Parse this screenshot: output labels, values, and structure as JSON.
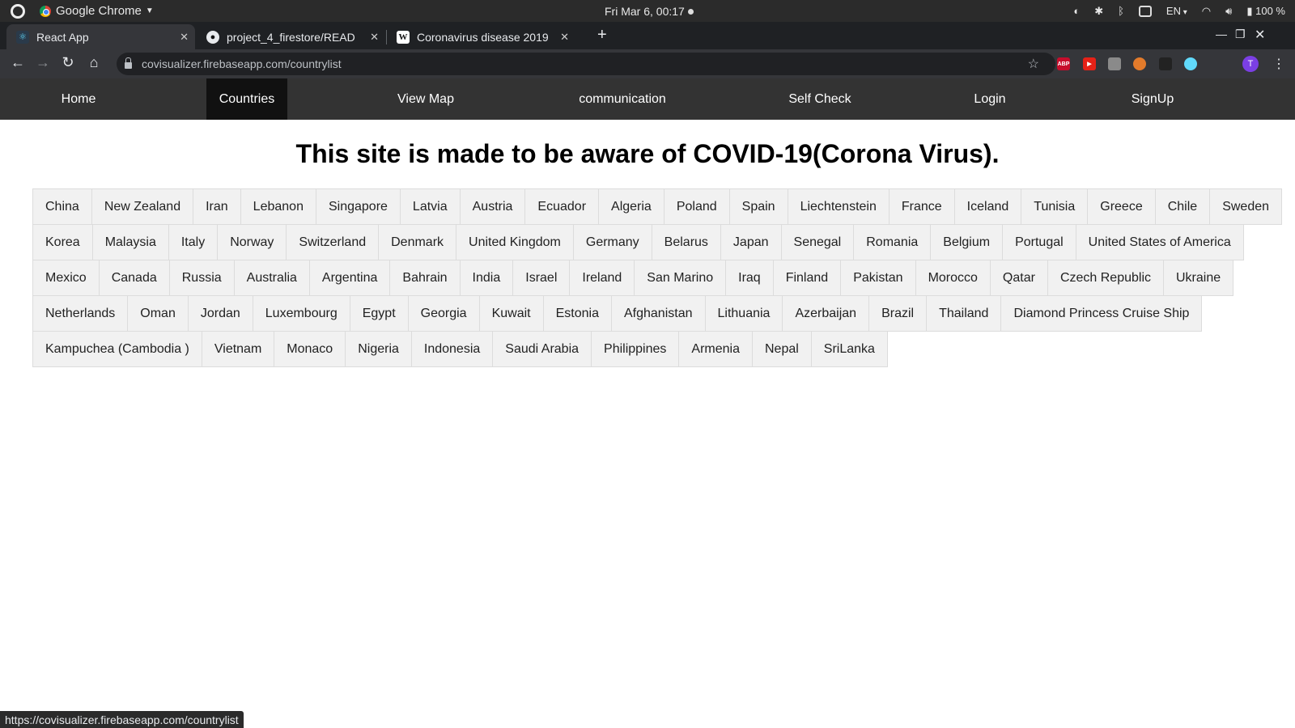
{
  "system_bar": {
    "app_name": "Google Chrome",
    "clock": "Fri Mar  6, 00:17",
    "language": "EN",
    "battery": "100 %"
  },
  "browser": {
    "tabs": [
      {
        "title": "React App",
        "icon": "react-icon",
        "active": true
      },
      {
        "title": "project_4_firestore/READ",
        "icon": "github-icon",
        "active": false
      },
      {
        "title": "Coronavirus disease 2019",
        "icon": "wikipedia-icon",
        "active": false
      }
    ],
    "url": "covisualizer.firebaseapp.com/countrylist",
    "profile_initial": "T",
    "extensions": [
      {
        "label": "ABP",
        "color": "#c70d2c"
      },
      {
        "label": "▶",
        "color": "#e62117"
      },
      {
        "label": "",
        "color": "#8a8a8a"
      },
      {
        "label": "",
        "color": "#e37b2b"
      },
      {
        "label": "",
        "color": "#222"
      },
      {
        "label": "",
        "color": "#61dafb"
      }
    ],
    "status_url": "https://covisualizer.firebaseapp.com/countrylist"
  },
  "nav": {
    "items": [
      {
        "label": "Home",
        "active": false
      },
      {
        "label": "Countries",
        "active": true
      },
      {
        "label": "View Map",
        "active": false
      },
      {
        "label": "communication",
        "active": false
      },
      {
        "label": "Self Check",
        "active": false
      },
      {
        "label": "Login",
        "active": false
      },
      {
        "label": "SignUp",
        "active": false
      }
    ]
  },
  "main": {
    "headline": "This site is made to be aware of COVID-19(Corona Virus).",
    "countries": [
      "China",
      "New Zealand",
      "Iran",
      "Lebanon",
      "Singapore",
      "Latvia",
      "Austria",
      "Ecuador",
      "Algeria",
      "Poland",
      "Spain",
      "Liechtenstein",
      "France",
      "Iceland",
      "Tunisia",
      "Greece",
      "Chile",
      "Sweden",
      "Korea",
      "Malaysia",
      "Italy",
      "Norway",
      "Switzerland",
      "Denmark",
      "United Kingdom",
      "Germany",
      "Belarus",
      "Japan",
      "Senegal",
      "Romania",
      "Belgium",
      "Portugal",
      "United States of America",
      "Mexico",
      "Canada",
      "Russia",
      "Australia",
      "Argentina",
      "Bahrain",
      "India",
      "Israel",
      "Ireland",
      "San Marino",
      "Iraq",
      "Finland",
      "Pakistan",
      "Morocco",
      "Qatar",
      "Czech Republic",
      "Ukraine",
      "Netherlands",
      "Oman",
      "Jordan",
      "Luxembourg",
      "Egypt",
      "Georgia",
      "Kuwait",
      "Estonia",
      "Afghanistan",
      "Lithuania",
      "Azerbaijan",
      "Brazil",
      "Thailand",
      "Diamond Princess Cruise Ship",
      "Kampuchea (Cambodia )",
      "Vietnam",
      "Monaco",
      "Nigeria",
      "Indonesia",
      "Saudi Arabia",
      "Philippines",
      "Armenia",
      "Nepal",
      "SriLanka"
    ]
  }
}
